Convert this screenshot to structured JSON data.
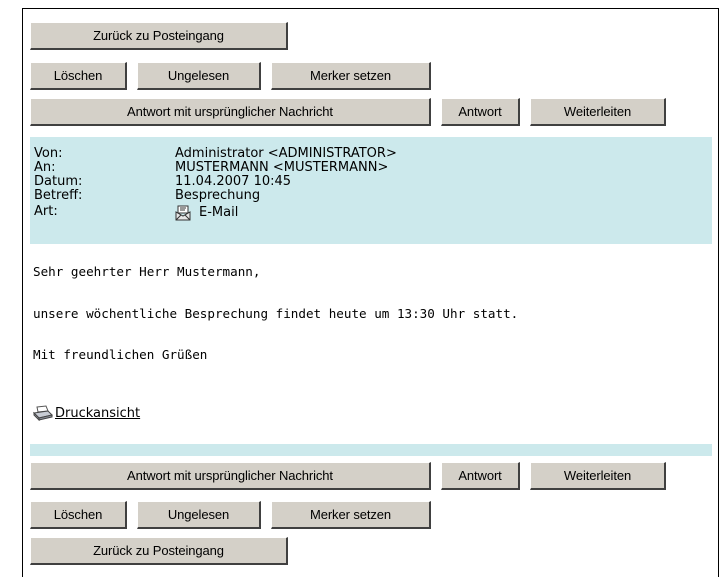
{
  "nav": {
    "back_label": "Zurück zu Posteingang",
    "delete_label": "Löschen",
    "unread_label": "Ungelesen",
    "flag_label": "Merker setzen",
    "reply_with_original_label": "Antwort mit ursprünglicher Nachricht",
    "reply_label": "Antwort",
    "forward_label": "Weiterleiten"
  },
  "header": {
    "from_label": "Von:",
    "from_value": "Administrator <ADMINISTRATOR>",
    "to_label": "An:",
    "to_value": "MUSTERMANN <MUSTERMANN>",
    "date_label": "Datum:",
    "date_value": "11.04.2007 10:45",
    "subject_label": "Betreff:",
    "subject_value": "Besprechung",
    "type_label": "Art:",
    "type_value": "E-Mail",
    "type_icon": "email-envelope-icon"
  },
  "message": {
    "greeting": "Sehr geehrter Herr Mustermann,",
    "body": "unsere wöchentliche Besprechung findet heute um 13:30 Uhr statt.",
    "closing": "Mit freundlichen Grüßen"
  },
  "print": {
    "label": " Druckansicht",
    "icon": "printer-icon"
  },
  "colors": {
    "header_bg": "#cce9ec",
    "button_bg": "#d4d0c8"
  }
}
